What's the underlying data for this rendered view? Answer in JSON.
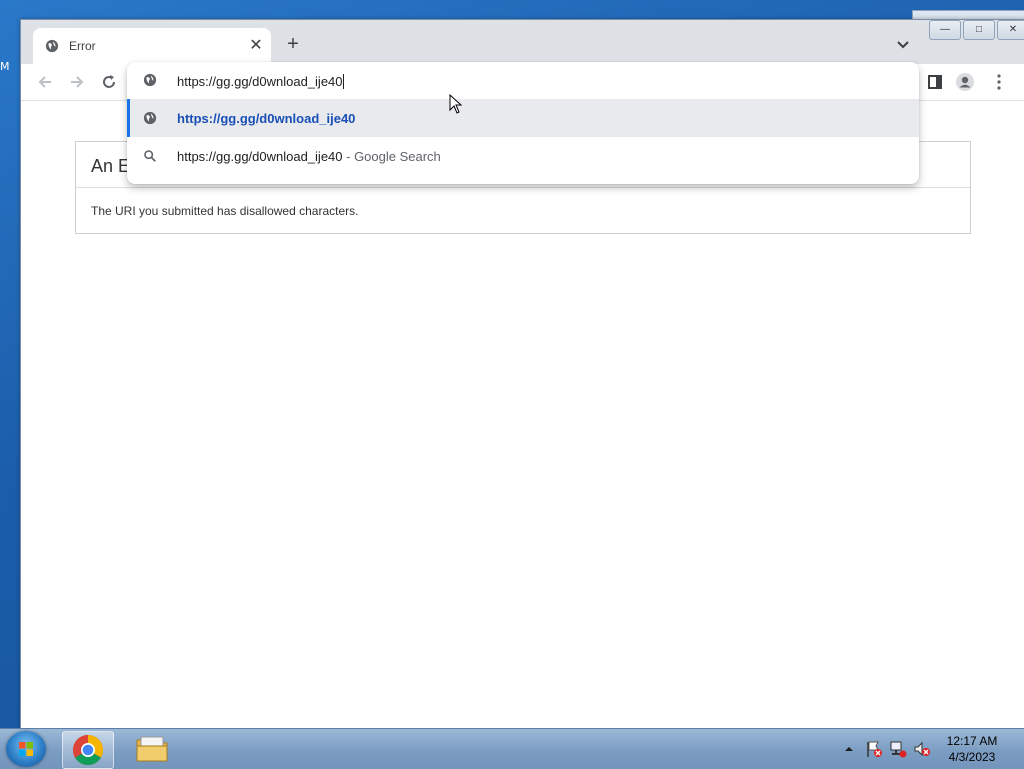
{
  "browser": {
    "tab": {
      "title": "Error",
      "close_icon": "close-icon"
    },
    "new_tab_label": "+",
    "window_controls": {
      "minimize": "—",
      "maximize": "□",
      "close": "✕"
    },
    "omnibox": {
      "value": "https://gg.gg/d0wnload_ije40",
      "suggestions": [
        {
          "text": "https://gg.gg/d0wnload_ije40",
          "suffix": "",
          "icon": "globe-icon",
          "selected": true
        },
        {
          "text": "https://gg.gg/d0wnload_ije40",
          "suffix": " - Google Search",
          "icon": "search-icon",
          "selected": false
        }
      ]
    }
  },
  "page": {
    "header_visible": "An E",
    "message": "The URI you submitted has disallowed characters."
  },
  "taskbar": {
    "time": "12:17 AM",
    "date": "4/3/2023"
  },
  "colors": {
    "accent": "#1a73e8",
    "selected_suggestion_text": "#1a4fb5"
  }
}
